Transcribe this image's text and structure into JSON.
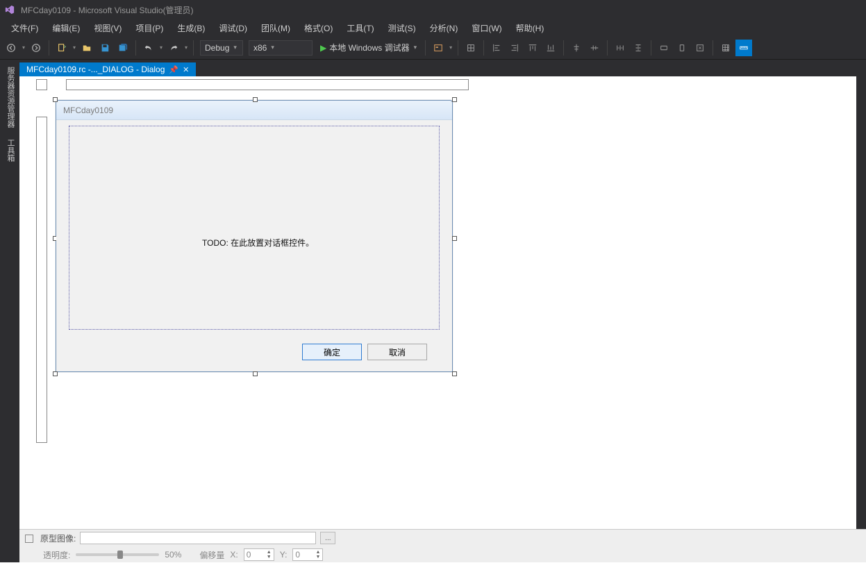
{
  "window": {
    "title": "MFCday0109 - Microsoft Visual Studio(管理员)"
  },
  "menu": {
    "items": [
      "文件(F)",
      "编辑(E)",
      "视图(V)",
      "项目(P)",
      "生成(B)",
      "调试(D)",
      "团队(M)",
      "格式(O)",
      "工具(T)",
      "测试(S)",
      "分析(N)",
      "窗口(W)",
      "帮助(H)"
    ]
  },
  "toolbar": {
    "config": "Debug",
    "platform": "x86",
    "run_label": "本地 Windows 调试器"
  },
  "tab": {
    "label": "MFCday0109.rc -..._DIALOG - Dialog"
  },
  "side": {
    "tab1": "服务器资源管理器",
    "tab2": "工具箱"
  },
  "dialog": {
    "title": "MFCday0109",
    "todo": "TODO: 在此放置对话框控件。",
    "ok": "确定",
    "cancel": "取消"
  },
  "status": {
    "proto_label": "原型图像:",
    "browse": "...",
    "opacity_label": "透明度:",
    "opacity_value": "50%",
    "offset_label": "偏移量",
    "x_label": "X:",
    "x_value": "0",
    "y_label": "Y:",
    "y_value": "0"
  }
}
